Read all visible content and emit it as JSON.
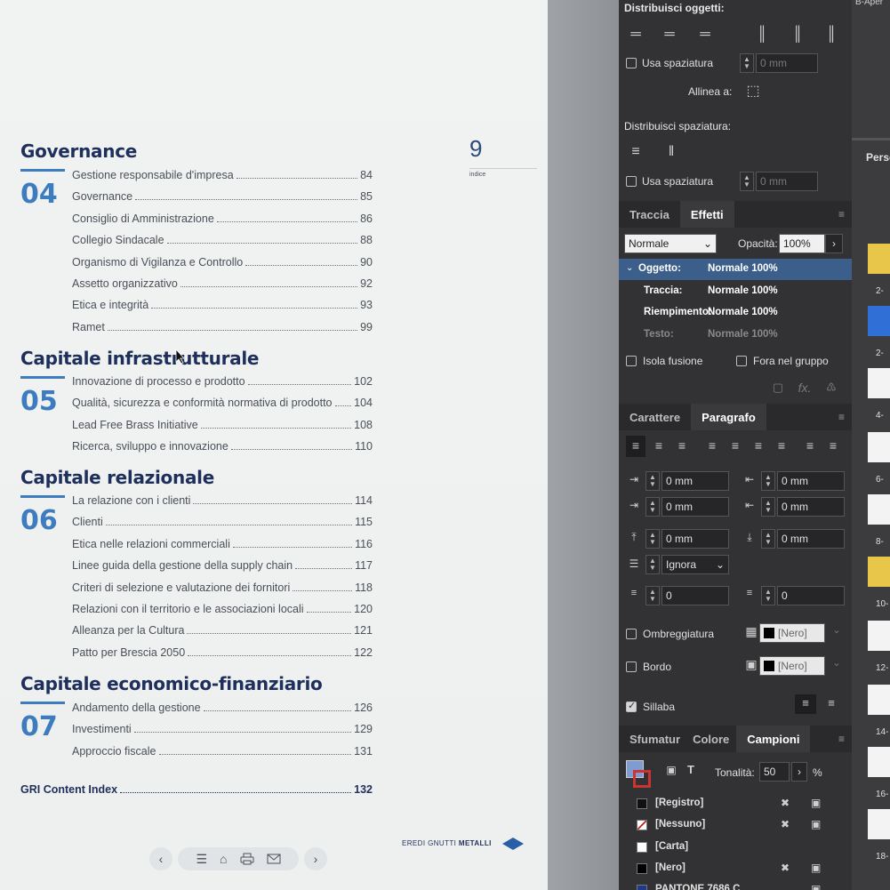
{
  "document": {
    "page_number": "9",
    "page_caption": "indice",
    "sections": [
      {
        "title": "Governance",
        "number": "04",
        "entries": [
          {
            "label": "Gestione responsabile d'impresa",
            "page": "84"
          },
          {
            "label": "Governance",
            "page": "85"
          },
          {
            "label": "Consiglio di Amministrazione",
            "page": "86"
          },
          {
            "label": "Collegio Sindacale",
            "page": "88"
          },
          {
            "label": "Organismo di Vigilanza e Controllo",
            "page": "90"
          },
          {
            "label": "Assetto organizzativo",
            "page": "92"
          },
          {
            "label": "Etica e integrità",
            "page": "93"
          },
          {
            "label": "Ramet",
            "page": "99"
          }
        ]
      },
      {
        "title": "Capitale infrastrutturale",
        "number": "05",
        "entries": [
          {
            "label": "Innovazione di processo e prodotto",
            "page": "102"
          },
          {
            "label": "Qualità, sicurezza e conformità normativa di prodotto",
            "page": "104"
          },
          {
            "label": "Lead Free Brass Initiative",
            "page": "108"
          },
          {
            "label": "Ricerca, sviluppo e innovazione",
            "page": "110"
          }
        ]
      },
      {
        "title": "Capitale relazionale",
        "number": "06",
        "entries": [
          {
            "label": "La relazione con i clienti",
            "page": "114"
          },
          {
            "label": "Clienti",
            "page": "115"
          },
          {
            "label": "Etica nelle relazioni commerciali",
            "page": "116"
          },
          {
            "label": "Linee guida della gestione della supply chain",
            "page": "117"
          },
          {
            "label": "Criteri di selezione e valutazione dei fornitori",
            "page": "118"
          },
          {
            "label": "Relazioni con il territorio e le associazioni locali",
            "page": "120"
          },
          {
            "label": "Alleanza per la Cultura",
            "page": "121"
          },
          {
            "label": "Patto per Brescia 2050",
            "page": "122"
          }
        ]
      },
      {
        "title": "Capitale economico-finanziario",
        "number": "07",
        "entries": [
          {
            "label": "Andamento della gestione",
            "page": "126"
          },
          {
            "label": "Investimenti",
            "page": "129"
          },
          {
            "label": "Approccio fiscale",
            "page": "131"
          }
        ]
      }
    ],
    "gri": {
      "label": "GRI Content Index",
      "page": "132"
    },
    "brand_light": "EREDI GNUTTI",
    "brand_bold": "METALLI",
    "colors": {
      "title": "#1f2f5c",
      "accent": "#3d7dbf"
    }
  },
  "align_panel": {
    "distribute_objects_label": "Distribuisci oggetti:",
    "use_spacing_label": "Usa spaziatura",
    "spacing_value_1": "0 mm",
    "align_to_label": "Allinea a:",
    "distribute_spacing_label": "Distribuisci spaziatura:",
    "use_spacing_label_2": "Usa spaziatura",
    "spacing_value_2": "0 mm"
  },
  "effects_panel": {
    "tabs": [
      "Traccia",
      "Effetti"
    ],
    "blend_mode": "Normale",
    "opacity_label": "Opacità:",
    "opacity_value": "100%",
    "rows": [
      {
        "label": "Oggetto:",
        "value": "Normale 100%"
      },
      {
        "label": "Traccia:",
        "value": "Normale 100%"
      },
      {
        "label": "Riempimento:",
        "value": "Normale 100%"
      },
      {
        "label": "Testo:",
        "value": "Normale 100%"
      }
    ],
    "isolate_label": "Isola fusione",
    "knockout_label": "Fora nel gruppo",
    "fx_label": "fx."
  },
  "paragraph_panel": {
    "tabs": [
      "Carattere",
      "Paragrafo"
    ],
    "left_indent": "0 mm",
    "right_indent": "0 mm",
    "first_line_indent": "0 mm",
    "last_line_indent": "0 mm",
    "space_before": "0 mm",
    "space_after": "0 mm",
    "align_grid": "Ignora",
    "drop_cap_lines": "0",
    "drop_cap_chars": "0",
    "shading_label": "Ombreggiatura",
    "shading_swatch": "[Nero]",
    "border_label": "Bordo",
    "border_swatch": "[Nero]",
    "hyphenate_label": "Sillaba"
  },
  "swatches_panel": {
    "tabs": [
      "Sfumatur",
      "Colore",
      "Campioni"
    ],
    "tint_label": "Tonalità:",
    "tint_value": "50",
    "tint_unit": "%",
    "swatches": [
      {
        "name": "[Registro]",
        "color": "#111111"
      },
      {
        "name": "[Nessuno]",
        "color": "#ffffff"
      },
      {
        "name": "[Carta]",
        "color": "#ffffff"
      },
      {
        "name": "[Nero]",
        "color": "#000000"
      },
      {
        "name": "PANTONE 7686 C",
        "color": "#1f3a8a"
      }
    ]
  },
  "pages_panel": {
    "header_label": "Perso",
    "top_label": "B-Aper",
    "page_labels": [
      "2-",
      "2-",
      "4-",
      "6-",
      "8-",
      "10-",
      "12-",
      "14-",
      "16-",
      "18-"
    ]
  }
}
